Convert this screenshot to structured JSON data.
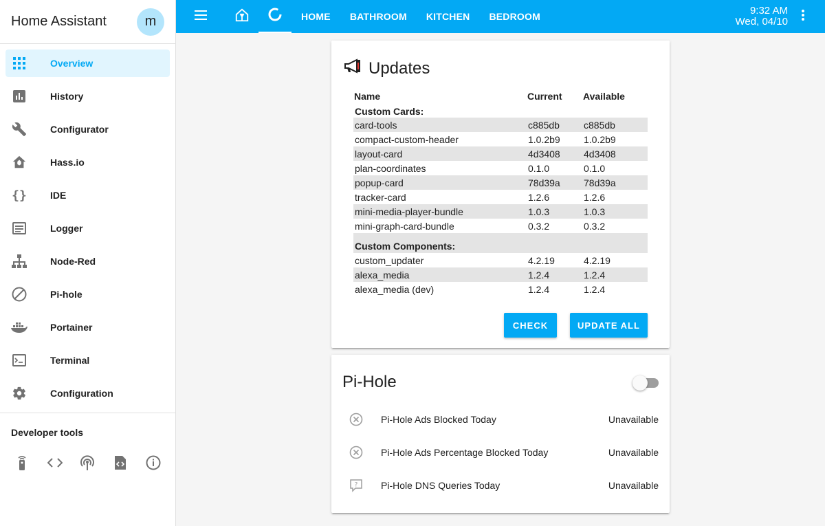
{
  "sidebar": {
    "title": "Home Assistant",
    "avatar_letter": "m",
    "items": [
      {
        "label": "Overview",
        "icon": "grid-icon",
        "active": true
      },
      {
        "label": "History",
        "icon": "chart-bar-icon"
      },
      {
        "label": "Configurator",
        "icon": "wrench-icon"
      },
      {
        "label": "Hass.io",
        "icon": "hass-io-icon"
      },
      {
        "label": "IDE",
        "icon": "braces-icon"
      },
      {
        "label": "Logger",
        "icon": "text-box-icon"
      },
      {
        "label": "Node-Red",
        "icon": "sitemap-icon"
      },
      {
        "label": "Pi-hole",
        "icon": "block-icon"
      },
      {
        "label": "Portainer",
        "icon": "docker-icon"
      },
      {
        "label": "Terminal",
        "icon": "console-icon"
      },
      {
        "label": "Configuration",
        "icon": "gear-icon"
      }
    ],
    "developer_tools_title": "Developer tools",
    "developer_tools": [
      "remote-icon",
      "code-tags-icon",
      "antenna-icon",
      "file-code-icon",
      "info-icon"
    ]
  },
  "topbar": {
    "tabs": [
      "HOME",
      "BATHROOM",
      "KITCHEN",
      "BEDROOM"
    ],
    "time": "9:32 AM",
    "date": "Wed, 04/10"
  },
  "updates": {
    "title": "Updates",
    "headers": {
      "name": "Name",
      "current": "Current",
      "available": "Available"
    },
    "sections": [
      {
        "title": "Custom Cards:",
        "rows": [
          {
            "name": "card-tools",
            "current": "c885db",
            "available": "c885db"
          },
          {
            "name": "compact-custom-header",
            "current": "1.0.2b9",
            "available": "1.0.2b9"
          },
          {
            "name": "layout-card",
            "current": "4d3408",
            "available": "4d3408"
          },
          {
            "name": "plan-coordinates",
            "current": "0.1.0",
            "available": "0.1.0"
          },
          {
            "name": "popup-card",
            "current": "78d39a",
            "available": "78d39a"
          },
          {
            "name": "tracker-card",
            "current": "1.2.6",
            "available": "1.2.6"
          },
          {
            "name": "mini-media-player-bundle",
            "current": "1.0.3",
            "available": "1.0.3"
          },
          {
            "name": "mini-graph-card-bundle",
            "current": "0.3.2",
            "available": "0.3.2"
          }
        ]
      },
      {
        "title": "Custom Components:",
        "rows": [
          {
            "name": "custom_updater",
            "current": "4.2.19",
            "available": "4.2.19"
          },
          {
            "name": "alexa_media",
            "current": "1.2.4",
            "available": "1.2.4"
          },
          {
            "name": "alexa_media (dev)",
            "current": "1.2.4",
            "available": "1.2.4"
          }
        ]
      }
    ],
    "check_label": "CHECK",
    "update_all_label": "UPDATE ALL"
  },
  "pihole": {
    "title": "Pi-Hole",
    "toggle_on": false,
    "rows": [
      {
        "label": "Pi-Hole Ads Blocked Today",
        "value": "Unavailable",
        "icon": "close-circle-icon"
      },
      {
        "label": "Pi-Hole Ads Percentage Blocked Today",
        "value": "Unavailable",
        "icon": "close-circle-icon"
      },
      {
        "label": "Pi-Hole DNS Queries Today",
        "value": "Unavailable",
        "icon": "comment-question-icon"
      }
    ]
  },
  "colors": {
    "accent": "#03a9f4",
    "active_bg": "#e1f5fe",
    "row_shade": "#e4e4e4",
    "icon_gray": "#727272"
  }
}
